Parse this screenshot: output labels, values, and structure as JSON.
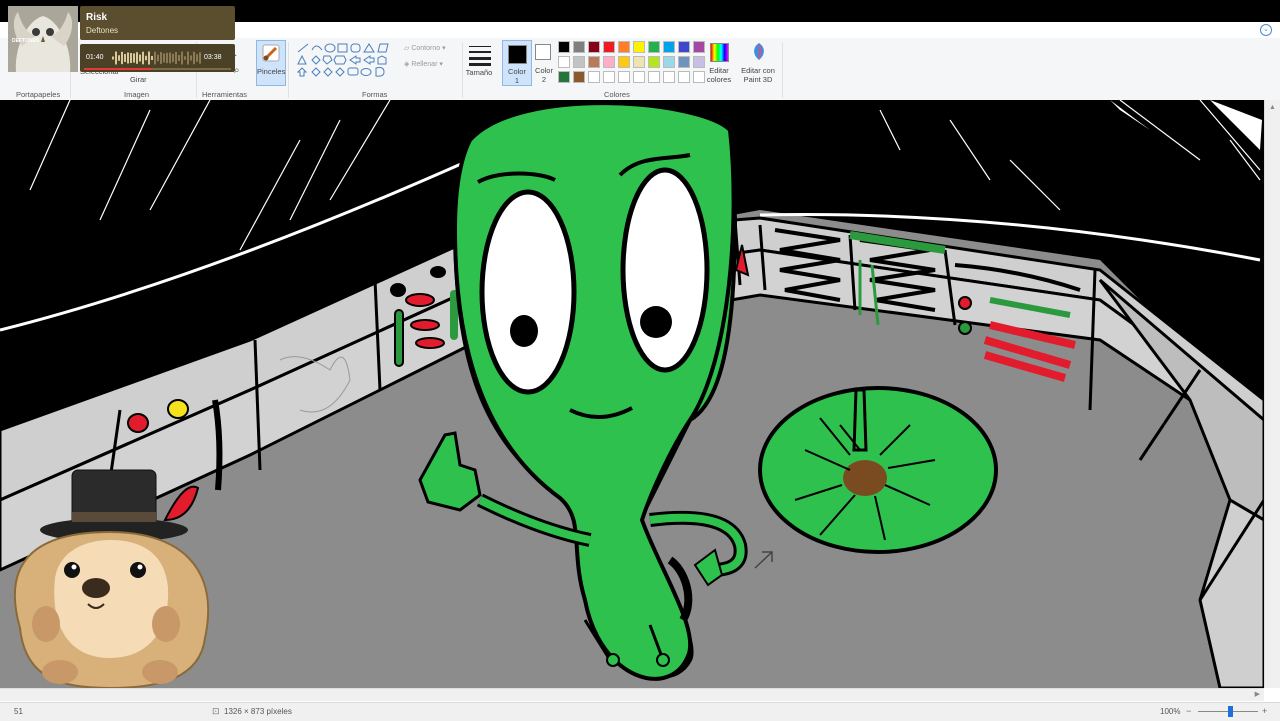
{
  "app": {
    "tabs_chevron_icon": "chevron-down-icon"
  },
  "ribbon": {
    "groups": {
      "clipboard": "Portapapeles",
      "image": "Imagen",
      "tools": "Herramientas",
      "shapes": "Formas",
      "colors": "Colores"
    },
    "image_buttons": {
      "select": "Seleccionar",
      "rotate": "Girar"
    },
    "brushes": "Pinceles",
    "shape_options": {
      "outline": "Contorno",
      "fill": "Rellenar"
    },
    "size": "Tamaño",
    "color1": {
      "line1": "Color",
      "line2": "1",
      "value": "#000000"
    },
    "color2": {
      "line1": "Color",
      "line2": "2",
      "value": "#ffffff"
    },
    "edit_colors": {
      "line1": "Editar",
      "line2": "colores"
    },
    "paint3d": {
      "line1": "Editar con",
      "line2": "Paint 3D"
    },
    "palette": [
      "#000000",
      "#7f7f7f",
      "#880015",
      "#ed1c24",
      "#ff7f27",
      "#fff200",
      "#22b14c",
      "#00a2e8",
      "#3f48cc",
      "#a349a4",
      "#ffffff",
      "#c3c3c3",
      "#b97a57",
      "#ffaec9",
      "#ffc90e",
      "#efe4b0",
      "#b5e61d",
      "#99d9ea",
      "#7092be",
      "#c8bfe7",
      "#22763a",
      "#8b5a2b",
      "#ffffff",
      "#ffffff",
      "#ffffff",
      "#ffffff",
      "#ffffff",
      "#ffffff",
      "#ffffff",
      "#ffffff"
    ]
  },
  "media_player": {
    "title": "Risk",
    "artist": "Deftones",
    "art_label": "DEFTONES",
    "elapsed": "01:40",
    "duration": "03:38",
    "progress": 0.46
  },
  "status": {
    "dimensions": "1326 × 873 píxeles",
    "zoom": "100%",
    "left_hint": "51"
  }
}
